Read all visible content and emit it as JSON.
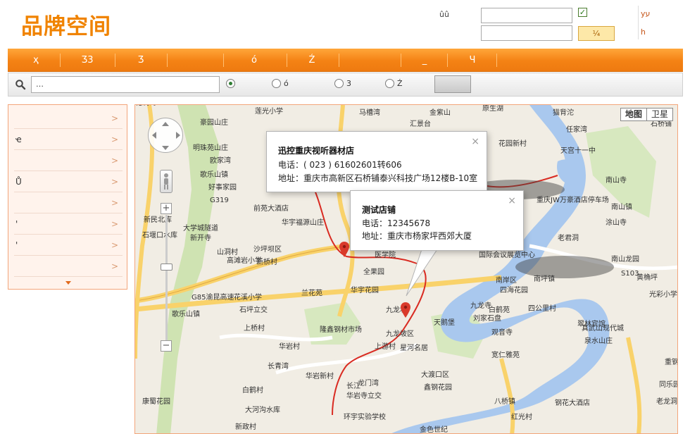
{
  "header": {
    "logo_text": "品牌空间",
    "username_label": "ûû",
    "password_label": "  ",
    "remember_label": "",
    "login_button": "¼",
    "link_register": "уע",
    "link_forgot": "һ"
  },
  "nav": {
    "items": [
      "ҳ",
      "Ʒ3",
      "Ʒ",
      "",
      "ó",
      "Ź",
      "",
      "_",
      "Ч"
    ]
  },
  "search": {
    "placeholder": "…",
    "options": [
      "",
      "ó",
      "3",
      "Ź"
    ],
    "selected_index": 0,
    "button": ""
  },
  "sidebar": {
    "items": [
      "",
      "ҽ",
      "",
      "Ů",
      "",
      "'",
      "'",
      ""
    ]
  },
  "map": {
    "type_buttons": [
      "地图",
      "卫星"
    ],
    "labels": [
      "莲光小学",
      "马槽湾",
      "金紫山",
      "原生湖",
      "猫背沱",
      "上江村",
      "豪园山庄",
      "汇景台",
      "任家湾",
      "石桥铺",
      "明珠苑山庄",
      "欧家湾",
      "花园新村",
      "天宫殿",
      "天宫十一中",
      "歌乐山镇",
      "好事家园",
      "南山寺",
      "重庆JW万豪酒店停车场",
      "G319",
      "新民北库",
      "前苑大酒店",
      "南山镇",
      "石堰口水库",
      "华宇福源山庄",
      "大学城隧道",
      "涂山寺",
      "新开寺",
      "山洞村",
      "沙坪坝区",
      "医学院",
      "老君洞",
      "高滩岩小学",
      "新桥村",
      "全果园",
      "国际会议展览中心",
      "南山龙园",
      "S103",
      "黄桷坪",
      "华宇花园",
      "南岸区",
      "南坪镇",
      "四海花园",
      "光彩小学",
      "G85渝昆高速",
      "花溪小学",
      "兰花苑",
      "九龙坡",
      "九龙寺",
      "白鹤苑",
      "四公里村",
      "歌乐山镇",
      "石坪立交",
      "刘家石盘",
      "翠林宾馆",
      "上桥村",
      "天鹅堡",
      "观音寺",
      "真武山现代城",
      "隆鑫钢材市场",
      "九龙坡区",
      "泉水山庄",
      "宽仁雅苑",
      "上游村",
      "星河名居",
      "华岩村",
      "重钢集团",
      "长青湾",
      "华岩新村",
      "大渡口区",
      "同乐园",
      "龙门湾",
      "鑫钢花园",
      "长江",
      "钢花大酒店",
      "老龙洞景区",
      "白鹤村",
      "华岩寺立交",
      "八桥镇",
      "康蜀花园",
      "大河沟水库",
      "新政村",
      "环宇实验学校",
      "金色世纪",
      "红光村",
      "花洞湾"
    ],
    "popup1": {
      "title": "迅控重庆视听器材店",
      "phone": "电话：( 023 ) 61602601转606",
      "address": "地址：重庆市高新区石桥铺泰兴科技广场12楼B-10室"
    },
    "popup2": {
      "title": "测试店铺",
      "phone": "电话：12345678",
      "address": "地址：重庆市杨家坪西郊大厦"
    }
  },
  "colors": {
    "brand_orange": "#f08300",
    "nav_orange": "#f48214",
    "sidebar_bg": "#fff3ec",
    "marker_red": "#d93a2b"
  }
}
